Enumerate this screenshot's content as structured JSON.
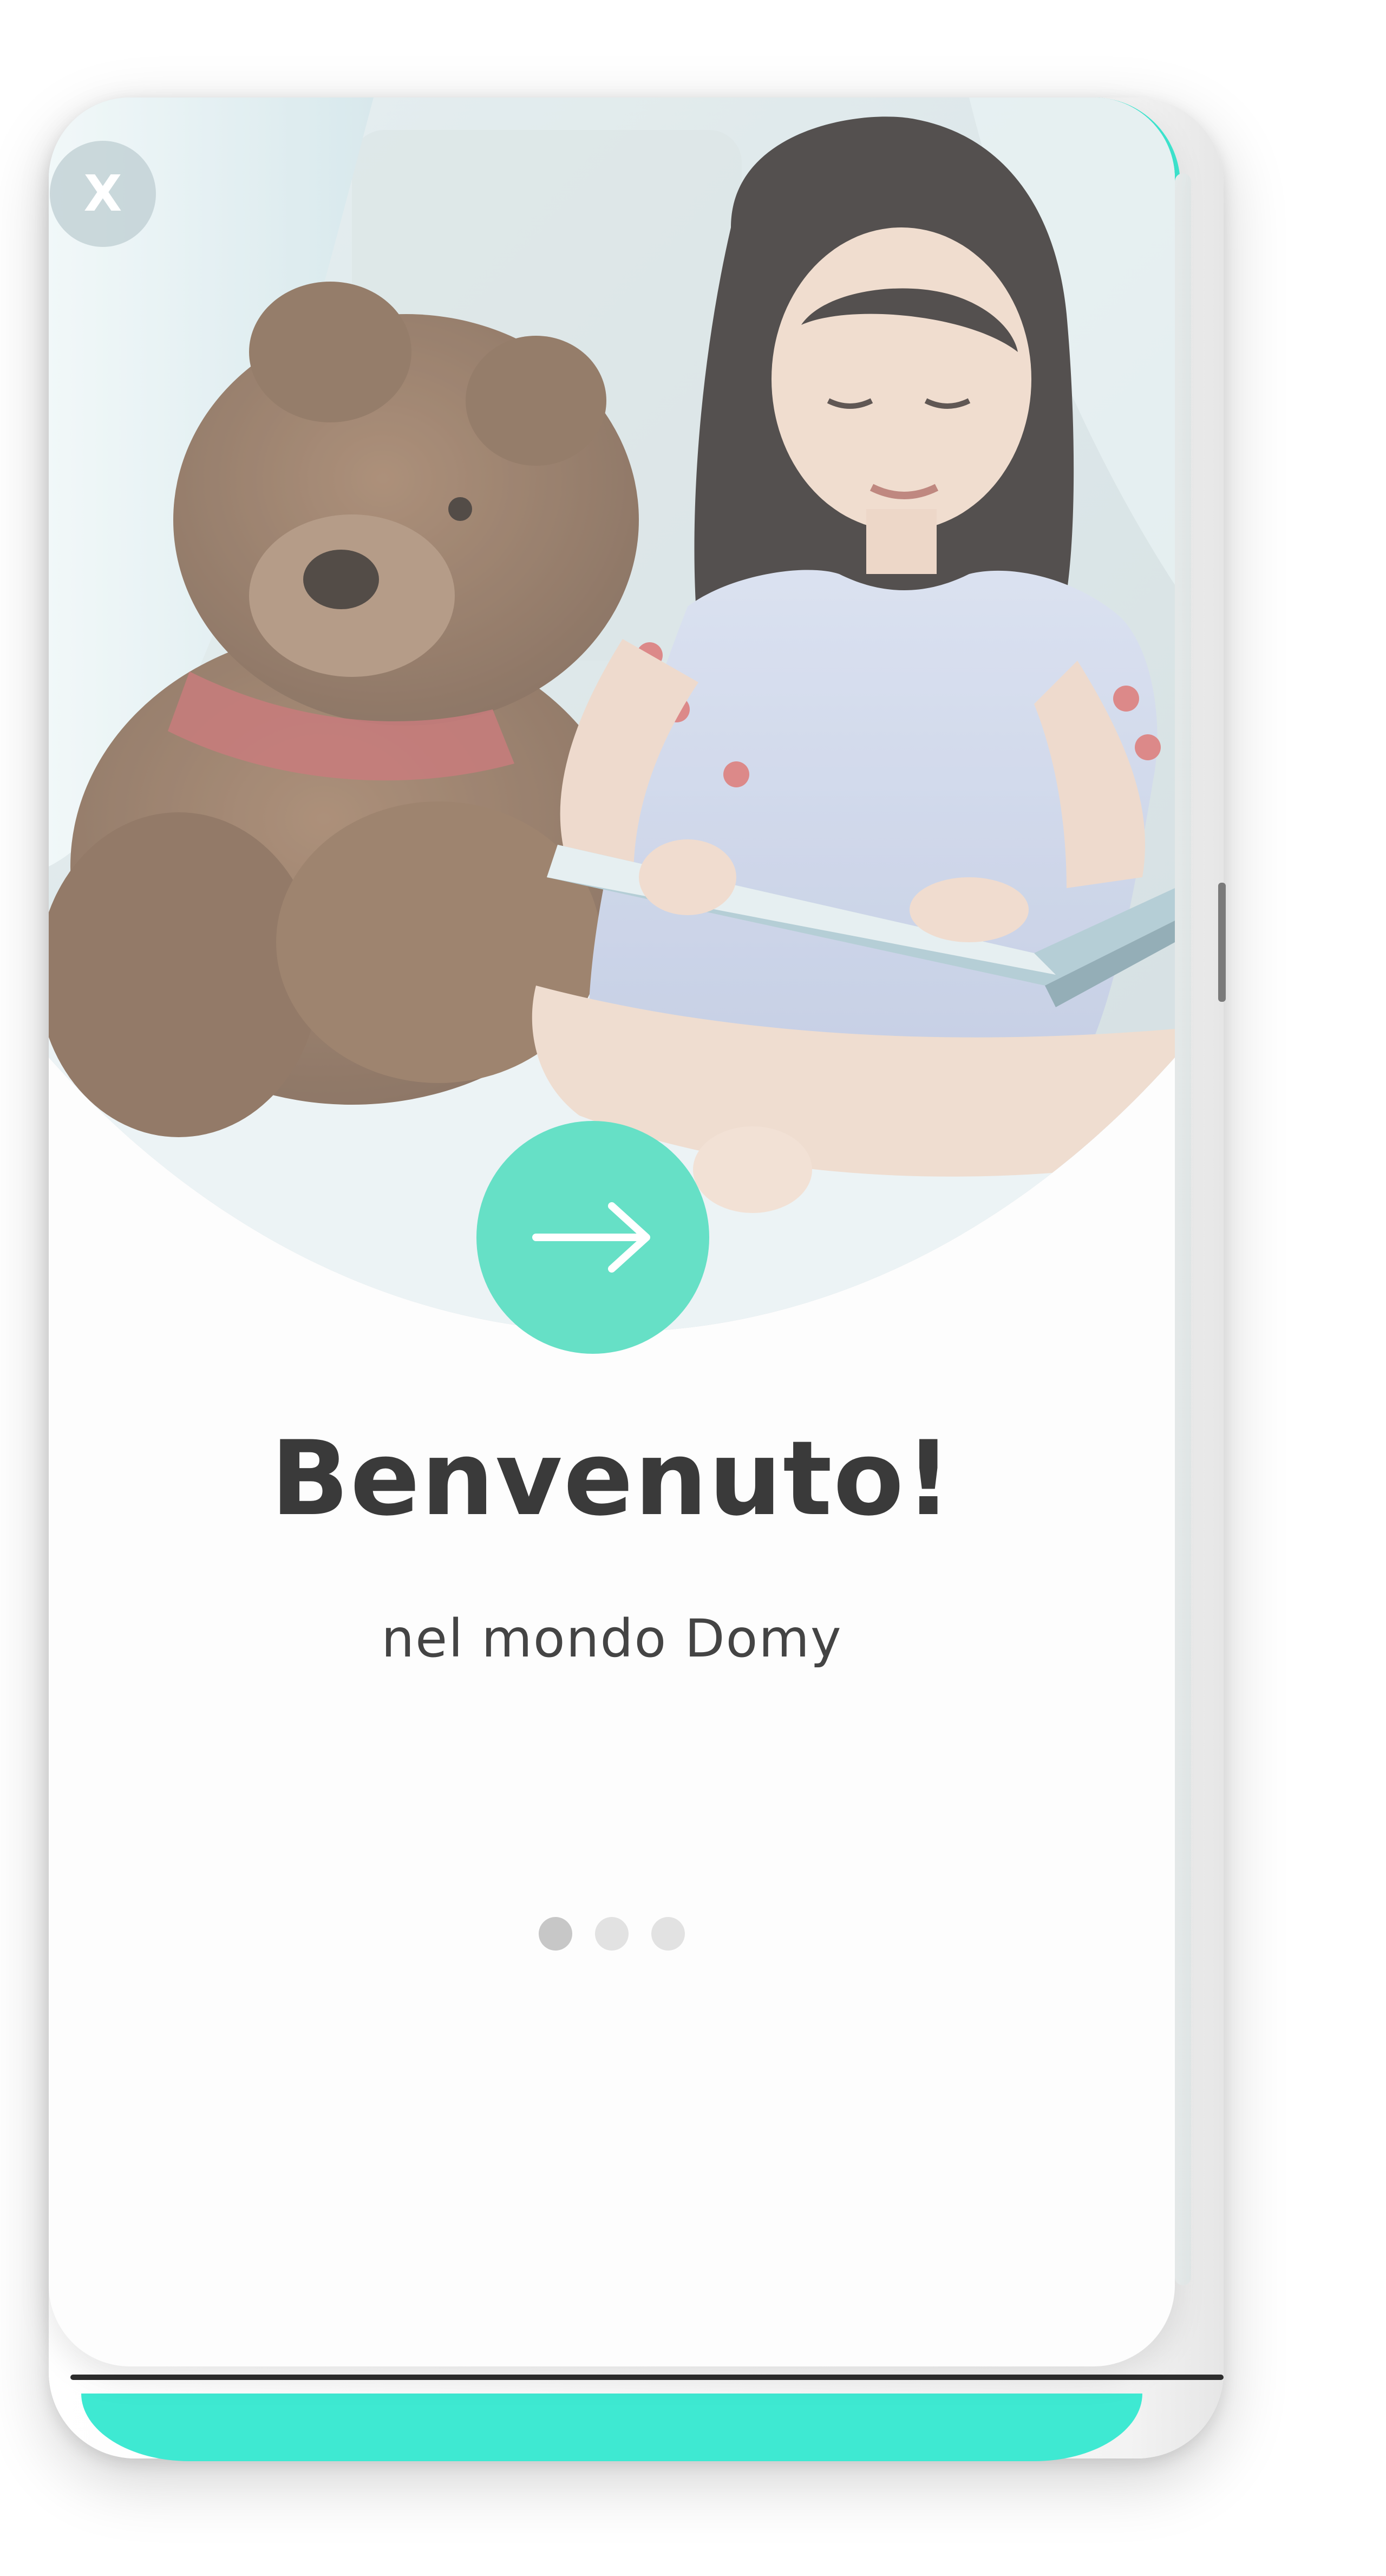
{
  "screen": {
    "close_label": "X",
    "title": "Benvenuto!",
    "subtitle": "nel mondo Domy"
  },
  "hero": {
    "image": "photo-girl-reading-with-teddy-bear"
  },
  "next_button": {
    "icon": "arrow-right-icon"
  },
  "pagination": {
    "total": 3,
    "current": 1
  },
  "colors": {
    "accent": "#3ee9d2",
    "button": "#66e0c6",
    "title_text": "#3a3a3a",
    "subtitle_text": "#444444",
    "dot_active": "#c7c7c7",
    "dot_inactive": "#e2e2e2"
  }
}
